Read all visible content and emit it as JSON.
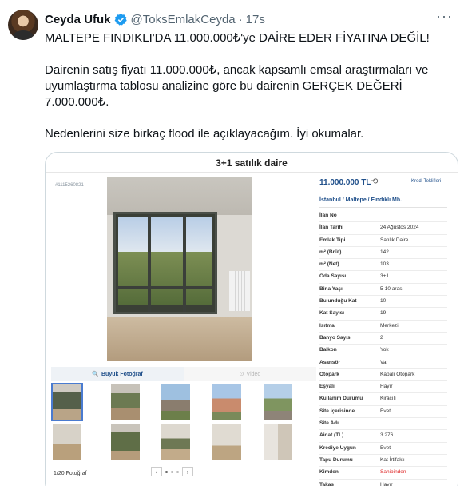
{
  "tweet": {
    "author_name": "Ceyda Ufuk",
    "handle": "@ToksEmlakCeyda",
    "separator": "·",
    "time": "17s",
    "more": "···",
    "paragraphs": [
      "MALTEPE FINDIKLI'DA 11.000.000₺'ye DAİRE EDER FİYATINA DEĞİL!",
      "Dairenin satış fiyatı 11.000.000₺, ancak kapsamlı emsal araştırmaları ve uyumlaştırma tablosu analizine göre bu dairenin GERÇEK DEĞERİ 7.000.000₺.",
      "Nedenlerini size birkaç flood ile açıklayacağım. İyi okumalar."
    ]
  },
  "colors": {
    "verified": "#1d9bf0",
    "link_blue": "#1f4f8a",
    "owner_red": "#dd2222"
  },
  "listing": {
    "title": "3+1 satılık daire",
    "listing_id": "#1115260821",
    "price": "11.000.000 TL",
    "price_icon": "history-icon",
    "credit_link": "Kredi Teklifleri",
    "location": "İstanbul  /  Maltepe  /  Fındıklı Mh.",
    "photo_button": "Büyük Fotoğraf",
    "video_button": "Video",
    "photo_count": "1/20 Fotoğraf",
    "pager_prev": "‹",
    "pager_next": "›",
    "details": [
      {
        "label": "İlan No",
        "value": ""
      },
      {
        "label": "İlan Tarihi",
        "value": "24 Ağustos 2024"
      },
      {
        "label": "Emlak Tipi",
        "value": "Satılık Daire"
      },
      {
        "label": "m² (Brüt)",
        "value": "142"
      },
      {
        "label": "m² (Net)",
        "value": "103"
      },
      {
        "label": "Oda Sayısı",
        "value": "3+1"
      },
      {
        "label": "Bina Yaşı",
        "value": "5-10 arası"
      },
      {
        "label": "Bulunduğu Kat",
        "value": "10"
      },
      {
        "label": "Kat Sayısı",
        "value": "19"
      },
      {
        "label": "Isıtma",
        "value": "Merkezi"
      },
      {
        "label": "Banyo Sayısı",
        "value": "2"
      },
      {
        "label": "Balkon",
        "value": "Yok"
      },
      {
        "label": "Asansör",
        "value": "Var"
      },
      {
        "label": "Otopark",
        "value": "Kapalı Otopark"
      },
      {
        "label": "Eşyalı",
        "value": "Hayır"
      },
      {
        "label": "Kullanım Durumu",
        "value": "Kiracılı"
      },
      {
        "label": "Site İçerisinde",
        "value": "Evet"
      },
      {
        "label": "Site Adı",
        "value": ""
      },
      {
        "label": "Aidat (TL)",
        "value": "3.276"
      },
      {
        "label": "Krediye Uygun",
        "value": "Evet"
      },
      {
        "label": "Tapu Durumu",
        "value": "Kat İrtifaklı"
      },
      {
        "label": "Kimden",
        "value": "Sahibinden"
      },
      {
        "label": "Takas",
        "value": "Hayır"
      }
    ]
  }
}
